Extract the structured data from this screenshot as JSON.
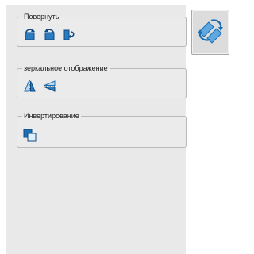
{
  "panel": {
    "groups": [
      {
        "title": "Повернуть",
        "icons": [
          "rotate-left-icon",
          "rotate-right-icon",
          "flip-rotate-icon"
        ]
      },
      {
        "title": "зеркальное отображение",
        "icons": [
          "mirror-horizontal-icon",
          "mirror-vertical-icon"
        ]
      },
      {
        "title": "Инвертирование",
        "icons": [
          "invert-icon"
        ]
      }
    ]
  },
  "big_button": {
    "icon": "rotate-cycle-icon"
  },
  "colors": {
    "accent": "#1c6fb5",
    "panel_bg": "#e9e9e9",
    "border": "#b9b9b9"
  }
}
